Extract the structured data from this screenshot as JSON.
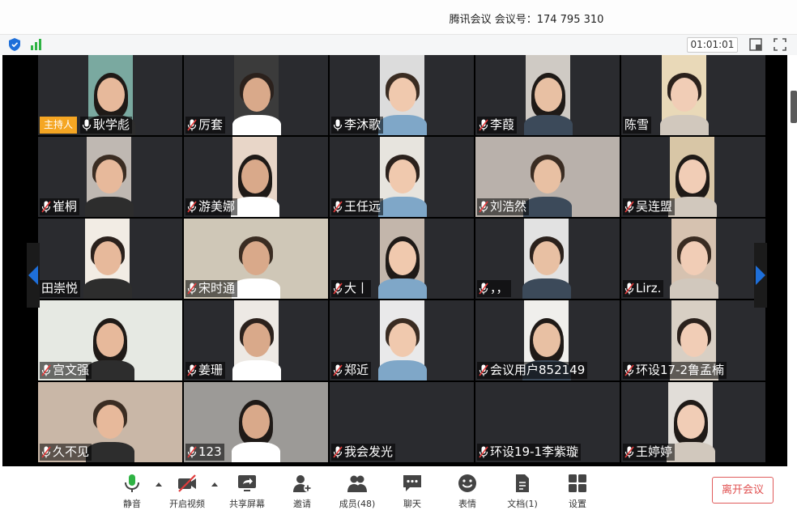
{
  "titlebar": {
    "title": "腾讯会议  会议号：174 795 310"
  },
  "statusbar": {
    "timer": "01:01:01"
  },
  "participants": [
    {
      "name": "耿学彪",
      "host": true,
      "host_label": "主持人",
      "muted": false
    },
    {
      "name": "厉套",
      "muted": true
    },
    {
      "name": "李沐歌",
      "muted": false
    },
    {
      "name": "李葭",
      "muted": true
    },
    {
      "name": "陈雪",
      "muted": null
    },
    {
      "name": "崔桐",
      "muted": true
    },
    {
      "name": "游美娜",
      "muted": true
    },
    {
      "name": "王任远",
      "muted": true
    },
    {
      "name": "刘浩然",
      "muted": true
    },
    {
      "name": "吴连盟",
      "muted": true
    },
    {
      "name": "田崇悦",
      "muted": null
    },
    {
      "name": "宋时通",
      "muted": true
    },
    {
      "name": "大丨",
      "muted": true
    },
    {
      "name": "，，",
      "muted": true
    },
    {
      "name": "Lirz.",
      "muted": true
    },
    {
      "name": "宫文强",
      "muted": true
    },
    {
      "name": "姜珊",
      "muted": true
    },
    {
      "name": "郑近",
      "muted": true
    },
    {
      "name": "会议用户852149",
      "muted": true
    },
    {
      "name": "环设17-2鲁孟楠",
      "muted": true
    },
    {
      "name": "久不见",
      "muted": true
    },
    {
      "name": "123",
      "muted": true
    },
    {
      "name": "我会发光",
      "muted": true
    },
    {
      "name": "环设19-1李紫璇",
      "muted": true
    },
    {
      "name": "王婷婷",
      "muted": true
    }
  ],
  "toolbar": {
    "mute": "静音",
    "video": "开启视频",
    "share": "共享屏幕",
    "invite": "邀请",
    "members": "成员(48)",
    "chat": "聊天",
    "reactions": "表情",
    "docs": "文档(1)",
    "settings": "设置",
    "leave": "离开会议"
  },
  "colors": {
    "accent": "#1e6fd9",
    "host_badge": "#f5a623",
    "leave": "#e05050",
    "signal": "#2fb344"
  }
}
